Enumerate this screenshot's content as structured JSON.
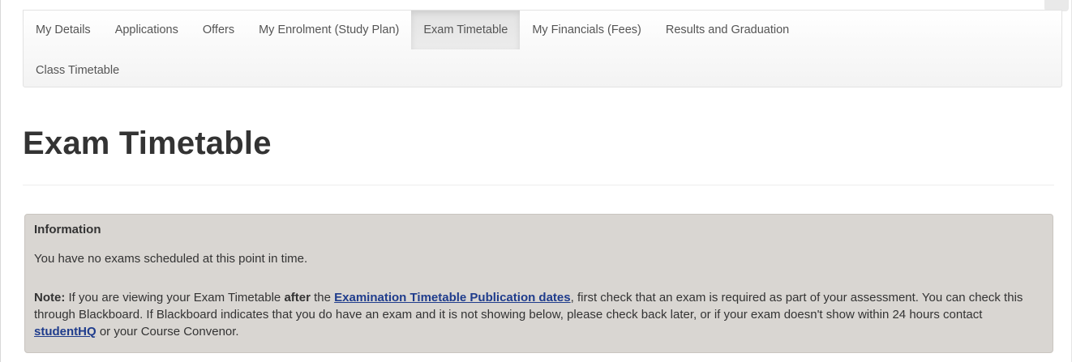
{
  "nav": {
    "items": [
      {
        "label": "My Details"
      },
      {
        "label": "Applications"
      },
      {
        "label": "Offers"
      },
      {
        "label": "My Enrolment (Study Plan)"
      },
      {
        "label": "Exam Timetable",
        "active": true
      },
      {
        "label": "My Financials (Fees)"
      },
      {
        "label": "Results and Graduation"
      },
      {
        "label": "Class Timetable"
      }
    ]
  },
  "page": {
    "title": "Exam Timetable"
  },
  "info": {
    "title": "Information",
    "message": "You have no exams scheduled at this point in time.",
    "note_label": "Note:",
    "note_part1": " If you are viewing your Exam Timetable ",
    "note_after": "after",
    "note_part2": " the ",
    "publication_link": "Examination Timetable Publication dates",
    "note_part3": ", first check that an exam is required as part of your assessment. You can check this through Blackboard. If Blackboard indicates that you do have an exam and it is not showing below, please check back later, or if your exam doesn't show within 24 hours contact ",
    "studenthq_link": "studentHQ",
    "note_part4": " or your Course Convenor."
  },
  "colors": {
    "link": "#1f3c8c",
    "panel_background": "#d9d6d2",
    "active_tab": "#e6e6e6"
  }
}
